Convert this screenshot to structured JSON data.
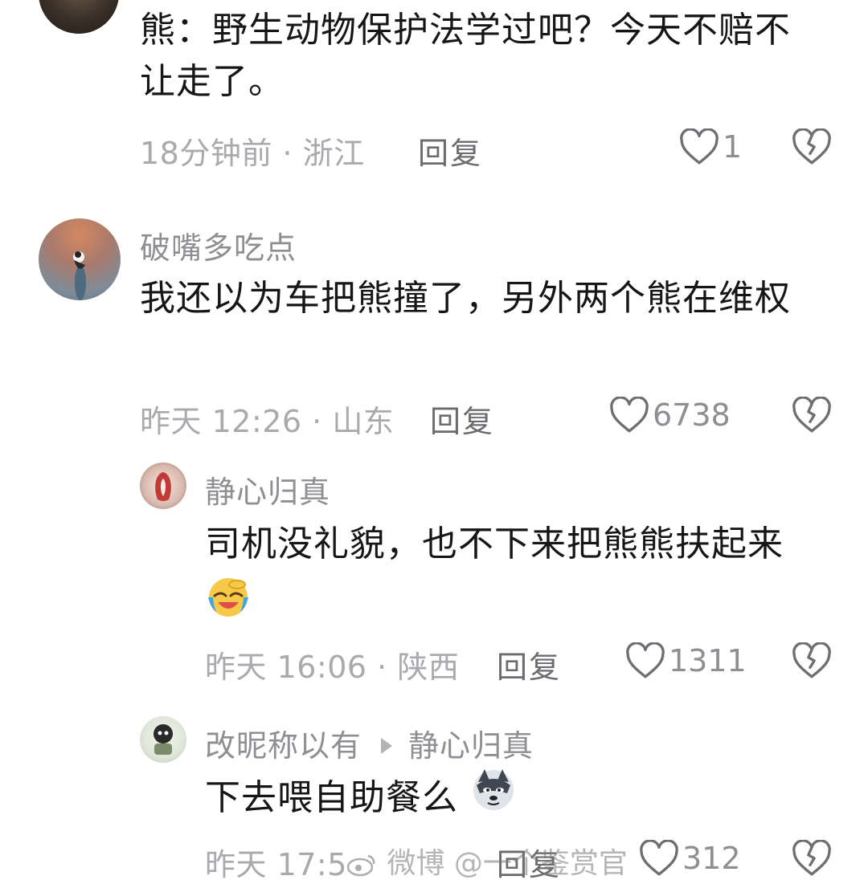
{
  "comments": [
    {
      "text": "熊：野生动物保护法学过吧？今天不赔不让走了。",
      "meta": "18分钟前 · 浙江",
      "reply": "回复",
      "likes": "1"
    },
    {
      "name": "破嘴多吃点",
      "text": "我还以为车把熊撞了，另外两个熊在维权",
      "meta": "昨天 12:26 · 山东",
      "reply": "回复",
      "likes": "6738"
    },
    {
      "name": "静心归真",
      "text": "司机没礼貌，也不下来把熊熊扶起来",
      "meta": "昨天 16:06 · 陕西",
      "reply": "回复",
      "likes": "1311"
    },
    {
      "name": "改昵称以有",
      "reply_to": "静心归真",
      "text": "下去喂自助餐么",
      "meta": "昨天 17:5",
      "reply": "回复",
      "likes": "312"
    }
  ],
  "watermark": "微博 @一个鉴赏官"
}
